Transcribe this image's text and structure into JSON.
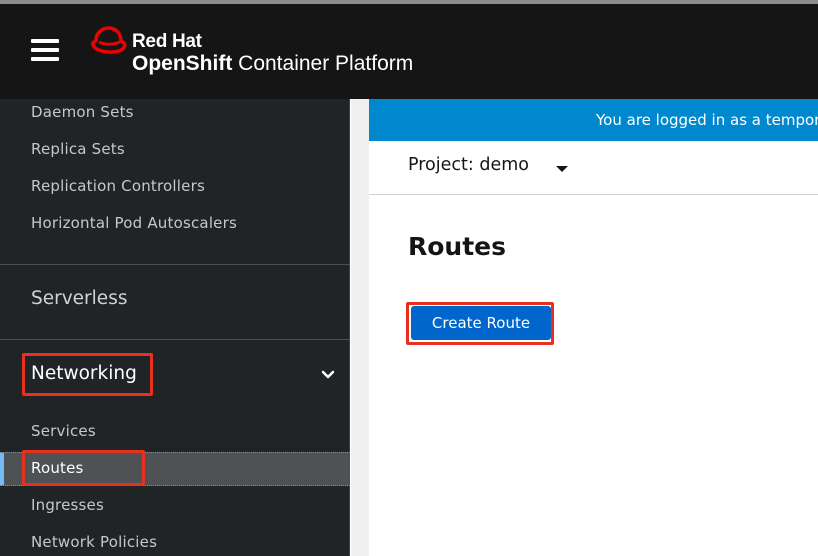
{
  "masthead": {
    "brand_primary": "Red Hat",
    "brand_product_bold": "OpenShift",
    "brand_product_rest": " Container Platform",
    "logo_icon": "redhat-logo-icon",
    "menu_icon": "hamburger-menu-icon"
  },
  "sidebar": {
    "workloads_items": [
      {
        "label": "Daemon Sets"
      },
      {
        "label": "Replica Sets"
      },
      {
        "label": "Replication Controllers"
      },
      {
        "label": "Horizontal Pod Autoscalers"
      }
    ],
    "serverless_label": "Serverless",
    "networking_label": "Networking",
    "networking_expanded_icon": "chevron-down-icon",
    "networking_items": [
      {
        "label": "Services"
      },
      {
        "label": "Routes",
        "active": true
      },
      {
        "label": "Ingresses"
      },
      {
        "label": "Network Policies"
      }
    ]
  },
  "main": {
    "banner_text": "You are logged in as a temporary administrative user.",
    "project_label": "Project: demo",
    "page_title": "Routes",
    "create_button_label": "Create Route"
  },
  "colors": {
    "masthead_bg": "#151515",
    "sidebar_bg": "#212427",
    "banner_bg": "#0088ce",
    "primary_button": "#0066cc",
    "highlight_outline": "#e8311c",
    "active_indicator": "#73bcf7"
  }
}
